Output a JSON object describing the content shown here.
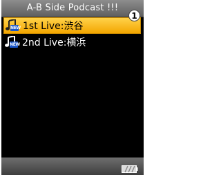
{
  "header": {
    "title": "A-B Side Podcast !!!"
  },
  "list": {
    "items": [
      {
        "label": "1st Live:渋谷",
        "badge": "NEW",
        "icon": "music-note-icon",
        "selected": true
      },
      {
        "label": "2nd Live:横浜",
        "badge": "NEW",
        "icon": "music-note-icon",
        "selected": false
      }
    ]
  },
  "callout": {
    "number": "1"
  },
  "status": {
    "icon": "battery-icon"
  },
  "colors": {
    "highlight": "#f8bb10",
    "background": "#000000",
    "badge": "#1a56c8"
  }
}
